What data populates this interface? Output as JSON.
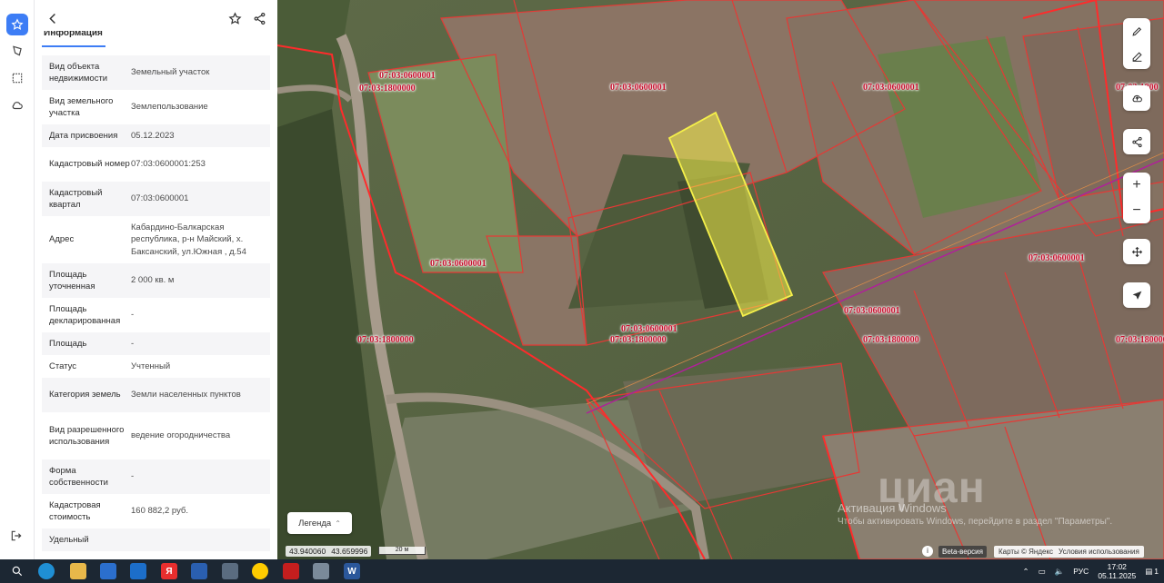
{
  "panel": {
    "tab_label": "Информация",
    "rows": [
      {
        "key": "Вид объекта недвижимости",
        "value": "Земельный участок"
      },
      {
        "key": "Вид земельного участка",
        "value": "Землепользование"
      },
      {
        "key": "Дата присвоения",
        "value": "05.12.2023"
      },
      {
        "key": "Кадастровый номер",
        "value": "07:03:0600001:253"
      },
      {
        "key": "Кадастровый квартал",
        "value": "07:03:0600001"
      },
      {
        "key": "Адрес",
        "value": "Кабардино-Балкарская республика, р-н Майский, х. Баксанский, ул.Южная , д.54"
      },
      {
        "key": "Площадь уточненная",
        "value": "2 000 кв. м"
      },
      {
        "key": "Площадь декларированная",
        "value": "-"
      },
      {
        "key": "Площадь",
        "value": "-"
      },
      {
        "key": "Статус",
        "value": "Учтенный"
      },
      {
        "key": "Категория земель",
        "value": "Земли населенных пунктов"
      },
      {
        "key": "Вид разрешенного использования",
        "value": "ведение огородничества"
      },
      {
        "key": "Форма собственности",
        "value": "-"
      },
      {
        "key": "Кадастровая стоимость",
        "value": "160 882,2 руб."
      },
      {
        "key": "Удельный",
        "value": ""
      }
    ]
  },
  "map": {
    "legend_label": "Легенда",
    "coord_lat": "43.940060",
    "coord_lon": "43.659996",
    "scale_label": "20 м",
    "beta_label": "Beta-версия",
    "attribution": "Карты © Яндекс",
    "terms_label": "Условия использования",
    "activation_title": "Активация Windows",
    "activation_sub": "Чтобы активировать Windows, перейдите в раздел \"Параметры\".",
    "watermark": "циан",
    "cadastral_labels": [
      "07:03:0600001",
      "07:03:1800000",
      "07:03:0600001",
      "07:03:0600001",
      "07:03:1800",
      "07:03:0600001",
      "07:03:0600001",
      "07:03:0600001",
      "07:03:1800000",
      "07:03:0600001",
      "07:03:1800000",
      "07:03:1800000",
      "07:03:1800000",
      "07:03:0600001"
    ]
  },
  "taskbar": {
    "lang": "РУС",
    "time": "17:02",
    "date": "05.11.2025",
    "notification_count": "1"
  },
  "colors": {
    "accent": "#3d7df5",
    "boundary": "#e53935",
    "selected_parcel": "#f5f04a",
    "label": "#c8102e"
  }
}
